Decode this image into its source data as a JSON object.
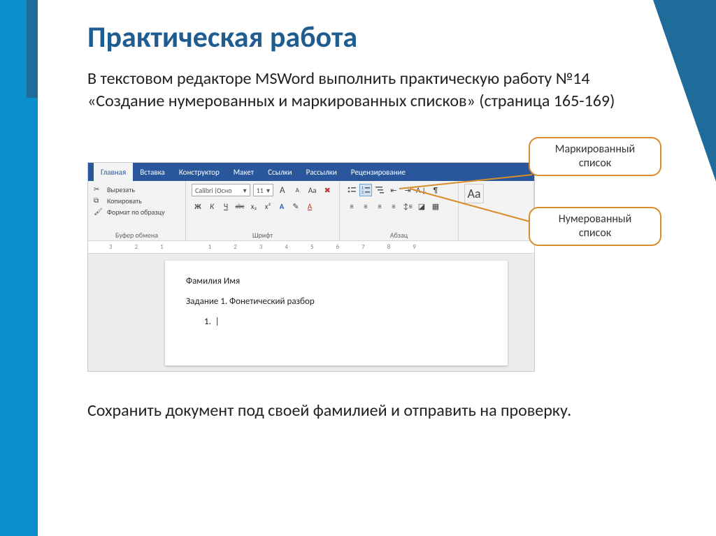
{
  "slide": {
    "title": "Практическая работа",
    "instruction": "В текстовом редакторе  MSWord выполнить практическую работу №14 «Создание нумерованных и маркированных списков» (страница 165-169)",
    "footer": "Сохранить документ под своей фамилией и отправить на проверку."
  },
  "callouts": {
    "bulleted": "Маркированный список",
    "numbered": "Нумерованный список"
  },
  "word": {
    "tabs": {
      "home": "Главная",
      "insert": "Вставка",
      "design": "Конструктор",
      "layout": "Макет",
      "references": "Ссылки",
      "mailings": "Рассылки",
      "review": "Рецензирование"
    },
    "clipboard": {
      "cut": "Вырезать",
      "copy": "Копировать",
      "paint": "Формат по образцу",
      "label": "Буфер обмена"
    },
    "font": {
      "name": "Calibri (Осно",
      "size": "11",
      "label": "Шрифт",
      "bold": "Ж",
      "italic": "К",
      "underline": "Ч",
      "strike": "abc",
      "sub": "x₂",
      "sup": "x²",
      "aa_big": "A",
      "aa_small": "A",
      "aa_case": "Aa",
      "clear": "✖",
      "fx": "A",
      "pen": "✎",
      "color": "A"
    },
    "para": {
      "label": "Абзац",
      "bullets": "•—",
      "numbers": "1—",
      "multi": "≡",
      "dec": "⇤",
      "inc": "⇥",
      "sort": "A↓",
      "pilcrow": "¶",
      "alignL": "≡",
      "alignC": "≡",
      "alignR": "≡",
      "alignJ": "≡",
      "linespc": "↕≡",
      "shade": "◪",
      "border": "▦"
    },
    "after": "Aa",
    "ruler": [
      "3",
      "2",
      "1",
      "",
      "1",
      "2",
      "3",
      "4",
      "5",
      "6",
      "7",
      "8",
      "9"
    ],
    "doc": {
      "line1": "Фамилия Имя",
      "line2": "Задание 1. Фонетический разбор",
      "num": "1.",
      "cursor": "|"
    }
  }
}
